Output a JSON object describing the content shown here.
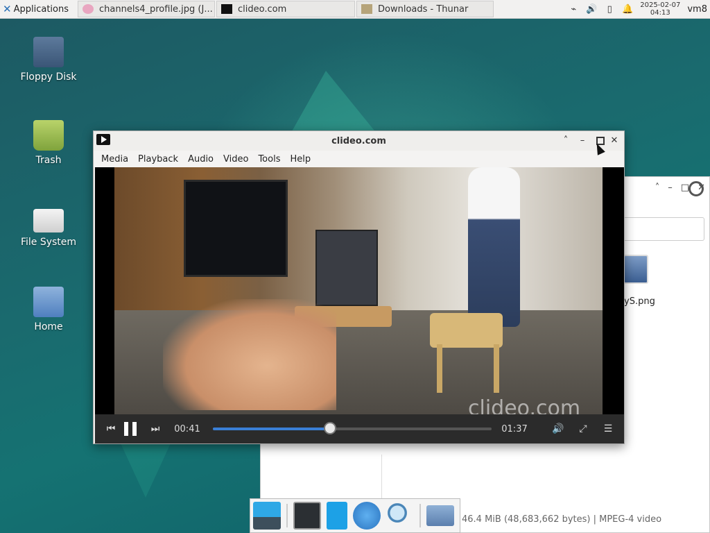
{
  "panel": {
    "applications_label": "Applications",
    "tasks": [
      {
        "label": "channels4_profile.jpg (J...",
        "icon": "image-viewer-icon"
      },
      {
        "label": "clideo.com",
        "icon": "vlc-icon"
      },
      {
        "label": "Downloads - Thunar",
        "icon": "folder-icon"
      }
    ],
    "clock_date": "2025-02-07",
    "clock_time": "04:13",
    "user": "vm8"
  },
  "desktop": {
    "icons": [
      {
        "label": "Floppy Disk",
        "icon": "floppy-disk-icon"
      },
      {
        "label": "Trash",
        "icon": "trash-icon"
      },
      {
        "label": "File System",
        "icon": "drive-icon"
      },
      {
        "label": "Home",
        "icon": "home-folder-icon"
      }
    ]
  },
  "thunar": {
    "file_name_visible": "yS.png",
    "status": "46.4 MiB (48,683,662 bytes)  |  MPEG-4 video"
  },
  "vlc": {
    "title": "clideo.com",
    "menu": [
      "Media",
      "Playback",
      "Audio",
      "Video",
      "Tools",
      "Help"
    ],
    "elapsed": "00:41",
    "total": "01:37",
    "progress_fraction": 0.42,
    "watermark": "clideo.com"
  },
  "colors": {
    "accent": "#3a7fd6",
    "controls_bg": "#2b2b2b"
  }
}
